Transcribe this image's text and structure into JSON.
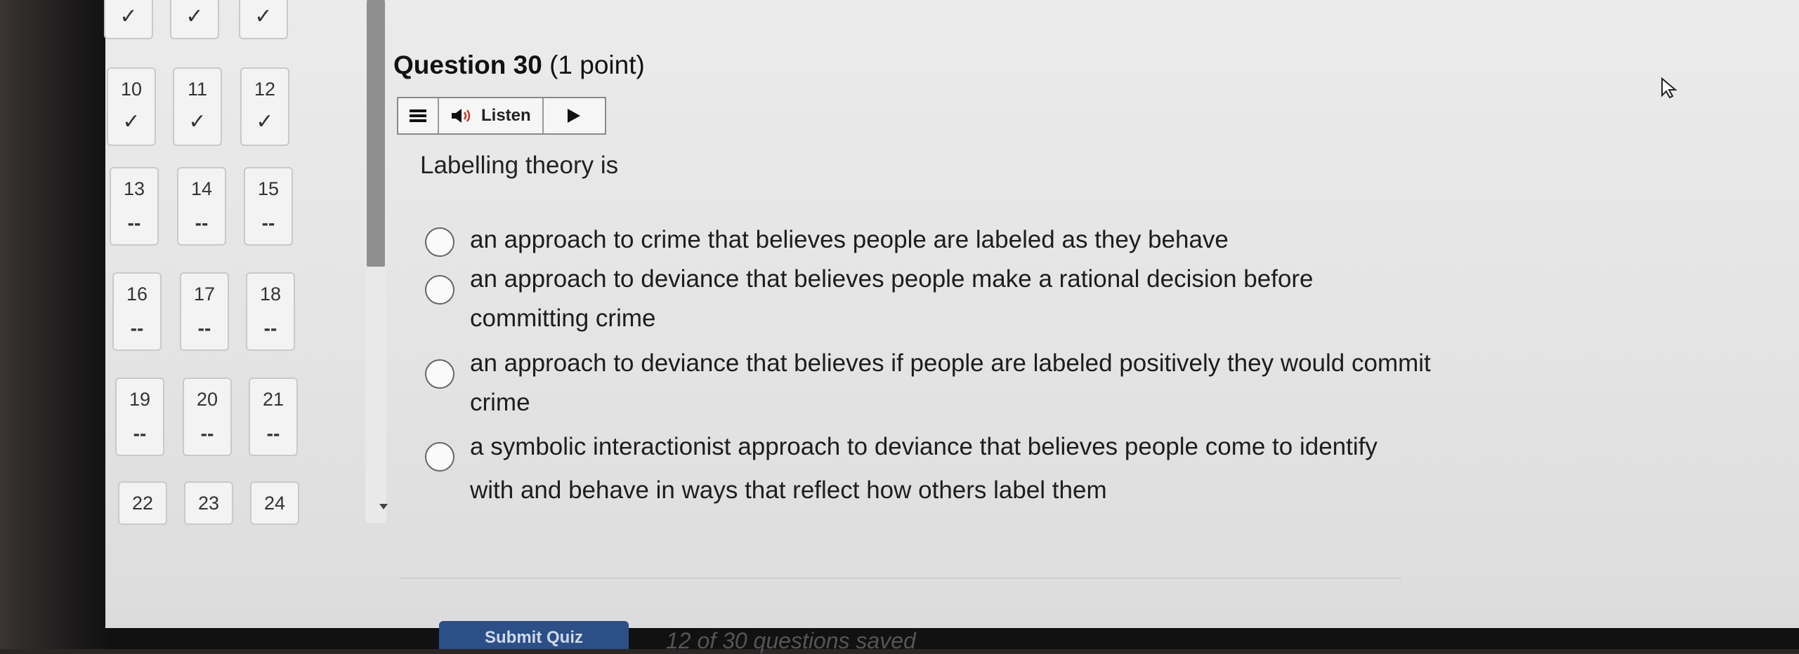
{
  "question": {
    "number_label": "Question 30",
    "points": "(1 point)",
    "prompt": "Labelling theory is",
    "options": [
      "an approach to crime that believes people are labeled as they behave",
      "an approach to deviance that believes people make a rational decision before committing crime",
      "an approach to deviance that believes if people are labeled positively they would commit crime",
      "a symbolic interactionist approach to deviance that believes people come to identify with and behave in ways that reflect how others label them"
    ]
  },
  "listen_bar": {
    "listen_label": "Listen"
  },
  "nav": {
    "top_row": [
      "✓",
      "✓",
      "✓"
    ],
    "cells": [
      {
        "num": "10",
        "status": "✓"
      },
      {
        "num": "11",
        "status": "✓"
      },
      {
        "num": "12",
        "status": "✓"
      },
      {
        "num": "13",
        "status": "--"
      },
      {
        "num": "14",
        "status": "--"
      },
      {
        "num": "15",
        "status": "--"
      },
      {
        "num": "16",
        "status": "--"
      },
      {
        "num": "17",
        "status": "--"
      },
      {
        "num": "18",
        "status": "--"
      },
      {
        "num": "19",
        "status": "--"
      },
      {
        "num": "20",
        "status": "--"
      },
      {
        "num": "21",
        "status": "--"
      },
      {
        "num": "22",
        "status": ""
      },
      {
        "num": "23",
        "status": ""
      },
      {
        "num": "24",
        "status": ""
      }
    ]
  },
  "footer": {
    "submit_label": "Submit Quiz",
    "saved_status": "12 of 30 questions saved"
  },
  "colors": {
    "submit": "#2b4f86",
    "background": "#e6e6e6"
  }
}
